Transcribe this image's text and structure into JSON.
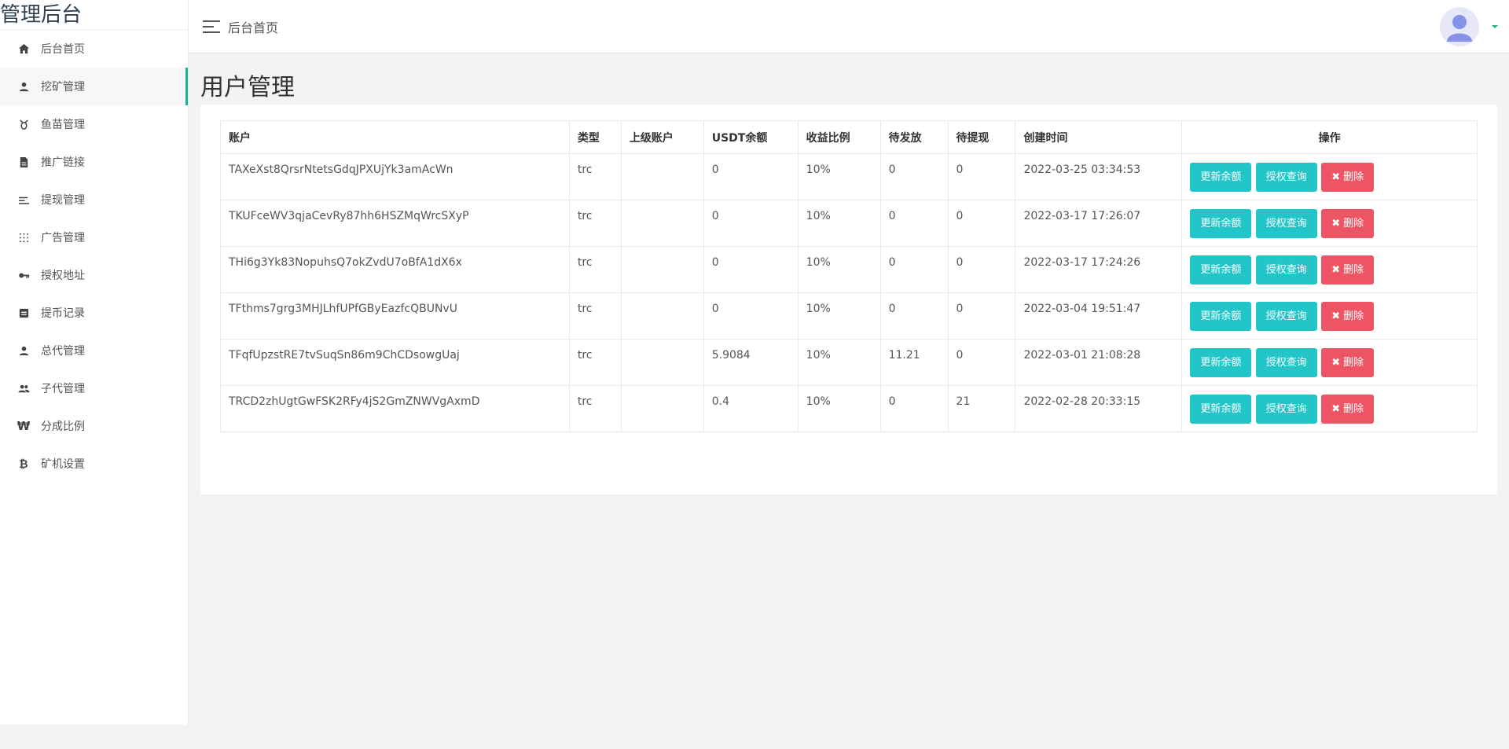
{
  "brand": "管理后台",
  "topbar": {
    "breadcrumb": "后台首页"
  },
  "sidebar": {
    "items": [
      {
        "label": "后台首页",
        "icon": "home-icon"
      },
      {
        "label": "挖矿管理",
        "icon": "user-icon"
      },
      {
        "label": "鱼苗管理",
        "icon": "bug-icon"
      },
      {
        "label": "推广链接",
        "icon": "file-icon"
      },
      {
        "label": "提现管理",
        "icon": "sort-lines-icon"
      },
      {
        "label": "广告管理",
        "icon": "grid-dots-icon"
      },
      {
        "label": "授权地址",
        "icon": "key-icon"
      },
      {
        "label": "提币记录",
        "icon": "ledger-icon"
      },
      {
        "label": "总代管理",
        "icon": "user-icon"
      },
      {
        "label": "子代管理",
        "icon": "users-icon"
      },
      {
        "label": "分成比例",
        "icon": "won-icon"
      },
      {
        "label": "矿机设置",
        "icon": "bitcoin-icon"
      }
    ]
  },
  "page": {
    "title": "用户管理"
  },
  "table": {
    "headers": [
      "账户",
      "类型",
      "上级账户",
      "USDT余额",
      "收益比例",
      "待发放",
      "待提现",
      "创建时间",
      "操作"
    ],
    "rows": [
      {
        "account": "TAXeXst8QrsrNtetsGdqJPXUjYk3amAcWn",
        "type": "trc",
        "parent": "",
        "usdt": "0",
        "ratio": "10%",
        "pending": "0",
        "withdraw": "0",
        "created": "2022-03-25 03:34:53"
      },
      {
        "account": "TKUFceWV3qjaCevRy87hh6HSZMqWrcSXyP",
        "type": "trc",
        "parent": "",
        "usdt": "0",
        "ratio": "10%",
        "pending": "0",
        "withdraw": "0",
        "created": "2022-03-17 17:26:07"
      },
      {
        "account": "THi6g3Yk83NopuhsQ7okZvdU7oBfA1dX6x",
        "type": "trc",
        "parent": "",
        "usdt": "0",
        "ratio": "10%",
        "pending": "0",
        "withdraw": "0",
        "created": "2022-03-17 17:24:26"
      },
      {
        "account": "TFthms7grg3MHJLhfUPfGByEazfcQBUNvU",
        "type": "trc",
        "parent": "",
        "usdt": "0",
        "ratio": "10%",
        "pending": "0",
        "withdraw": "0",
        "created": "2022-03-04 19:51:47"
      },
      {
        "account": "TFqfUpzstRE7tvSuqSn86m9ChCDsowgUaj",
        "type": "trc",
        "parent": "",
        "usdt": "5.9084",
        "ratio": "10%",
        "pending": "11.21",
        "withdraw": "0",
        "created": "2022-03-01 21:08:28"
      },
      {
        "account": "TRCD2zhUgtGwFSK2RFy4jS2GmZNWVgAxmD",
        "type": "trc",
        "parent": "",
        "usdt": "0.4",
        "ratio": "10%",
        "pending": "0",
        "withdraw": "21",
        "created": "2022-02-28 20:33:15"
      }
    ],
    "actions": {
      "update": "更新余额",
      "query": "授权查询",
      "delete": "删除"
    }
  },
  "colors": {
    "teal": "#23c6c8",
    "red": "#ed5565",
    "active_border": "#1ab394"
  }
}
